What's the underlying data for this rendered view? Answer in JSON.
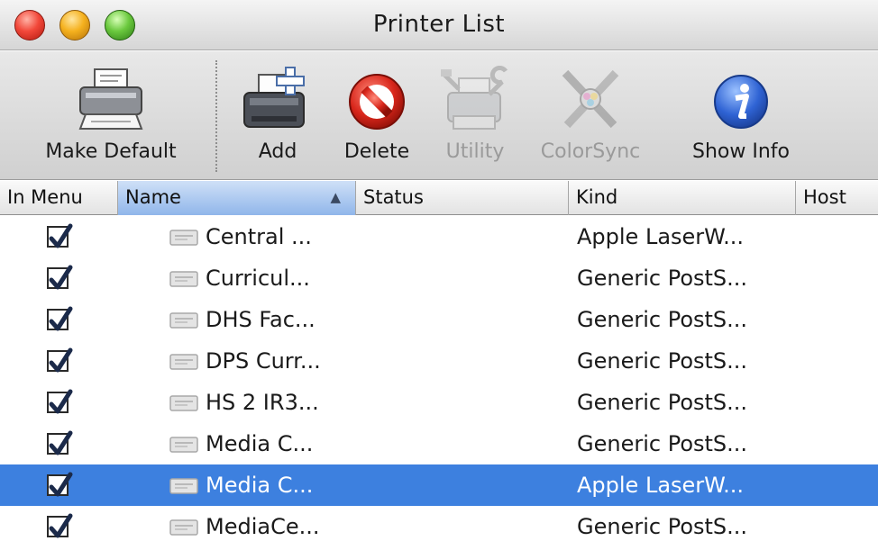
{
  "window": {
    "title": "Printer List"
  },
  "toolbar": {
    "make_default": "Make Default",
    "add": "Add",
    "delete": "Delete",
    "utility": "Utility",
    "colorsync": "ColorSync",
    "show_info": "Show Info"
  },
  "table": {
    "columns": {
      "in_menu": "In Menu",
      "name": "Name",
      "status": "Status",
      "kind": "Kind",
      "host": "Host"
    },
    "sorted_by": "Name",
    "selected_row": 6,
    "rows": [
      {
        "in_menu": true,
        "name": "Central ...",
        "status": "",
        "kind": "Apple LaserW...",
        "host": ""
      },
      {
        "in_menu": true,
        "name": "Curricul...",
        "status": "",
        "kind": "Generic PostS...",
        "host": ""
      },
      {
        "in_menu": true,
        "name": "DHS Fac...",
        "status": "",
        "kind": "Generic PostS...",
        "host": ""
      },
      {
        "in_menu": true,
        "name": "DPS Curr...",
        "status": "",
        "kind": "Generic PostS...",
        "host": ""
      },
      {
        "in_menu": true,
        "name": "HS 2 IR3...",
        "status": "",
        "kind": "Generic PostS...",
        "host": ""
      },
      {
        "in_menu": true,
        "name": "Media C...",
        "status": "",
        "kind": "Generic PostS...",
        "host": ""
      },
      {
        "in_menu": true,
        "name": "Media C...",
        "status": "",
        "kind": "Apple LaserW...",
        "host": ""
      },
      {
        "in_menu": true,
        "name": "MediaCe...",
        "status": "",
        "kind": "Generic PostS...",
        "host": ""
      }
    ]
  },
  "colors": {
    "selection": "#3d80df",
    "sorted_header": "#90b6ea",
    "delete_red": "#d8261b",
    "info_blue": "#2f63d4"
  },
  "icons": {
    "make_default": "printer-icon",
    "add": "printer-add-icon",
    "delete": "no-entry-icon",
    "utility": "printer-tools-icon",
    "colorsync": "colorsync-icon",
    "show_info": "info-icon"
  }
}
